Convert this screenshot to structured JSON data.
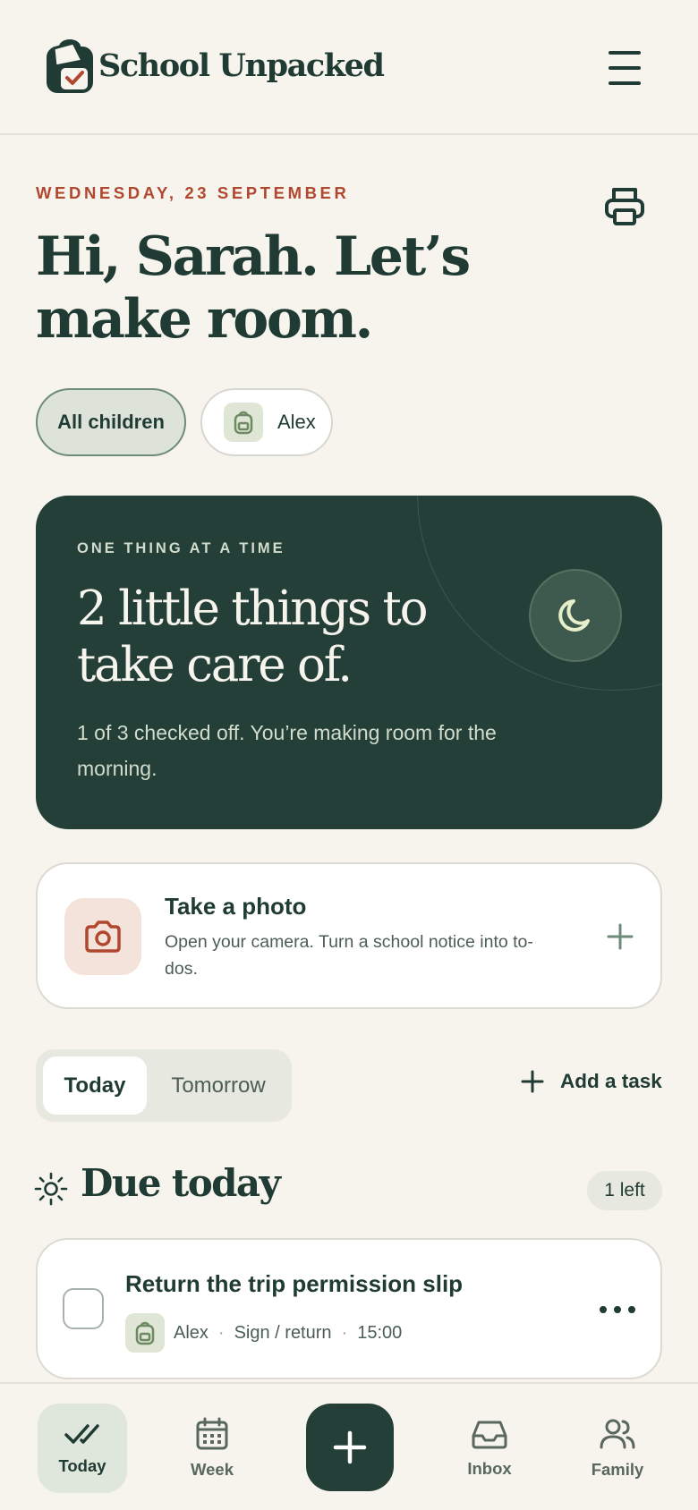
{
  "header": {
    "app_name": "School Unpacked",
    "logo_icon": "backpack-check-icon",
    "menu_icon": "hamburger-menu-icon"
  },
  "today": {
    "date": "WEDNESDAY, 23 SEPTEMBER",
    "greeting": "Hi, Sarah. Let’s make room.",
    "print_icon": "printer-icon"
  },
  "filters": {
    "all_children": "All children",
    "child": "Alex",
    "child_icon": "backpack-icon"
  },
  "hero": {
    "eyebrow": "ONE THING AT A TIME",
    "title": "2 little things to take care of.",
    "subtitle": "1 of 3 checked off. You’re making room for the morning.",
    "icon": "moon-icon"
  },
  "photo_card": {
    "title": "Take a photo",
    "subtitle": "Open your camera. Turn a school notice into to-dos.",
    "icon": "camera-icon",
    "action_icon": "plus-icon"
  },
  "day_toggle": {
    "today": "Today",
    "tomorrow": "Tomorrow",
    "selected": "Today"
  },
  "add_task": {
    "label": "Add a task",
    "icon": "plus-icon"
  },
  "due_today": {
    "title": "Due today",
    "count": "1 left",
    "icon": "sun-icon"
  },
  "tasks": [
    {
      "title": "Return the trip permission slip",
      "child": "Alex",
      "category": "Sign / return",
      "time": "15:00",
      "checked": false,
      "more_icon": "more-dots-icon"
    }
  ],
  "bottom_nav": {
    "items": [
      {
        "label": "Today",
        "icon": "double-check-icon",
        "active": true
      },
      {
        "label": "Week",
        "icon": "calendar-icon",
        "active": false
      },
      {
        "label": "Inbox",
        "icon": "inbox-icon",
        "active": false
      },
      {
        "label": "Family",
        "icon": "people-icon",
        "active": false
      }
    ],
    "fab_icon": "plus-icon"
  },
  "colors": {
    "background": "#f7f4ee",
    "primary": "#233f38",
    "accent": "#b0472e",
    "sage": "#dfe6d5",
    "photo_tint": "#f4e3da"
  }
}
